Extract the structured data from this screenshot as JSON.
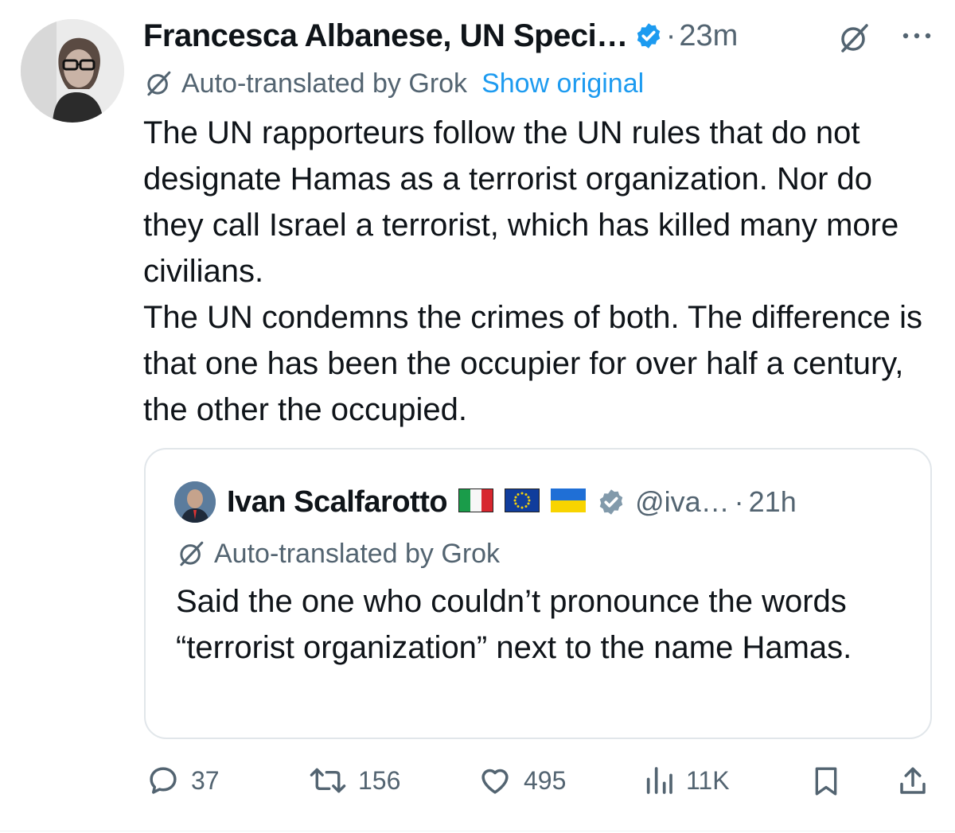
{
  "tweet": {
    "author_name": "Francesca Albanese, UN Speci…",
    "separator": "·",
    "time": "23m",
    "translated_by": "Auto-translated by Grok",
    "show_original": "Show original",
    "body": [
      "The UN rapporteurs follow the UN rules that do not designate Hamas as a terrorist organization. Nor do they call Israel a terrorist, which has killed many more civilians.",
      "The UN condemns the crimes of both. The difference is that one has been the occupier for over half a century, the other the occupied."
    ]
  },
  "quote": {
    "author_name": "Ivan Scalfarotto",
    "handle": "@iva…",
    "separator": "·",
    "time": "21h",
    "translated_by": "Auto-translated by Grok",
    "body": "Said the one who couldn’t pronounce the words “terrorist organization” next to the name Hamas.",
    "flags": [
      "italy-flag",
      "eu-flag",
      "ukraine-flag"
    ]
  },
  "actions": {
    "replies": "37",
    "reposts": "156",
    "likes": "495",
    "views": "11K"
  },
  "colors": {
    "text": "#0f1419",
    "secondary": "#536471",
    "link": "#1d9bf0",
    "verified": "#1d9bf0",
    "border": "#e1e6ea"
  }
}
